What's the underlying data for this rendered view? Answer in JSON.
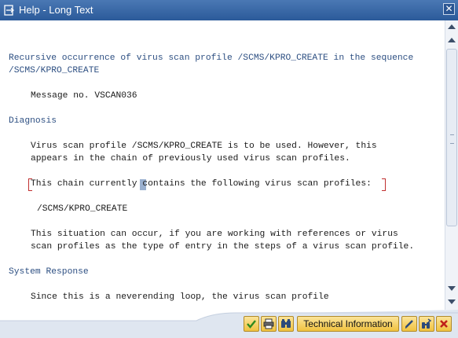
{
  "window": {
    "title": "Help - Long Text",
    "close_glyph": "✕"
  },
  "content": {
    "heading_line1": "Recursive occurrence of virus scan profile /SCMS/KPRO_CREATE in the sequence",
    "heading_line2": "/SCMS/KPRO_CREATE",
    "message_no": "Message no. VSCAN036",
    "diagnosis_heading": "Diagnosis",
    "diag_line1": "Virus scan profile /SCMS/KPRO_CREATE is to be used. However, this",
    "diag_line2": "appears in the chain of previously used virus scan profiles.",
    "chain_line": "This chain currently contains the following virus scan profiles:",
    "profile": "/SCMS/KPRO_CREATE",
    "situation_line1": "This situation can occur, if you are working with references or virus",
    "situation_line2": "scan profiles as the type of entry in the steps of a virus scan profile.",
    "system_response_heading": "System Response",
    "response_line1": "Since this is a neverending loop, the virus scan profile"
  },
  "toolbar": {
    "technical_info_label": "Technical Information",
    "icons": [
      "check-icon",
      "print-icon",
      "find-icon",
      "edit-icon",
      "find-next-icon",
      "cancel-icon"
    ]
  },
  "colors": {
    "title_bar": "#2b5a9a",
    "heading_text": "#2d4f82",
    "button_fill": "#f0c23f",
    "footer": "#dfe6f0"
  }
}
